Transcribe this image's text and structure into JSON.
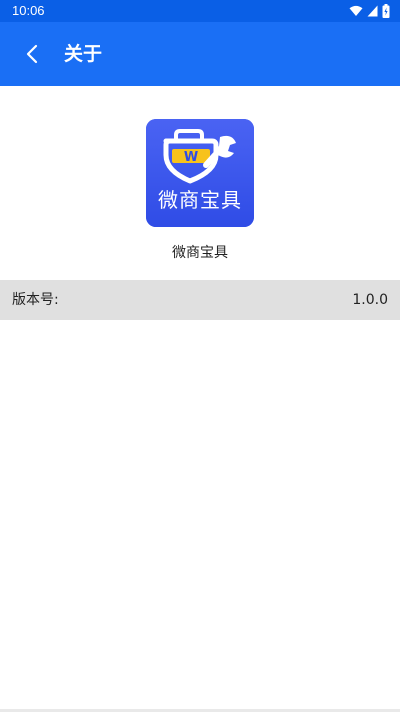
{
  "status_bar": {
    "time": "10:06",
    "background": "#0a5fe6",
    "icons": [
      "wifi-icon",
      "signal-icon",
      "battery-icon"
    ]
  },
  "app_bar": {
    "title": "关于",
    "background": "#1a6ff5",
    "back_icon": "chevron-left-icon"
  },
  "app_info": {
    "logo_text": "微商宝具",
    "logo_letter": "W",
    "name": "微商宝具",
    "logo_background": "#3d5bf0",
    "logo_accent": "#f7c21b"
  },
  "version": {
    "label": "版本号:",
    "value": "1.0.0"
  }
}
